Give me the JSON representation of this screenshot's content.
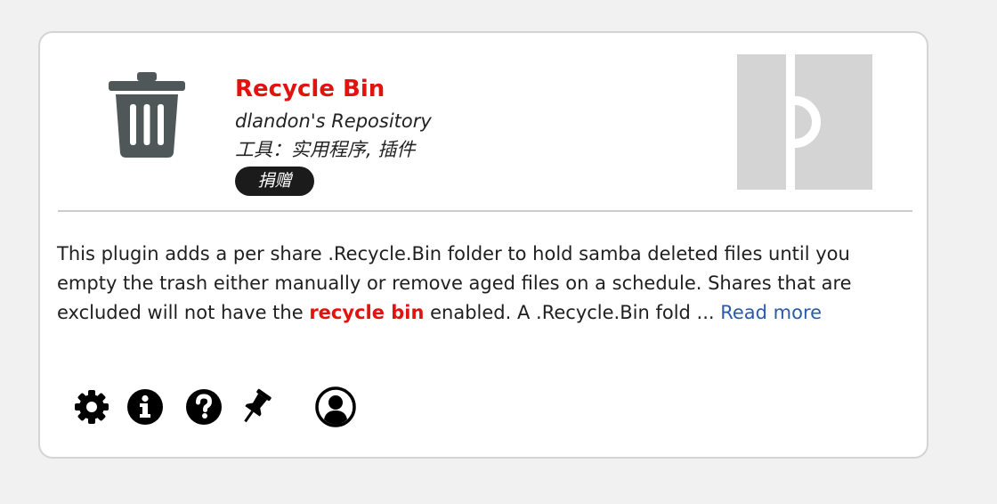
{
  "plugin": {
    "title": "Recycle Bin",
    "repository": "dlandon's Repository",
    "category": "工具：实用程序, 插件",
    "donate_label": "捐赠",
    "icon": "trash-icon",
    "author_logo": "author-logo-icon"
  },
  "description": {
    "text_before": "This plugin adds a per share .Recycle.Bin folder to hold samba deleted files until you empty the trash either manually or remove aged files on a schedule. Shares that are excluded will not have the ",
    "highlight": "recycle bin",
    "text_after": " enabled. A .Recycle.Bin fold ... ",
    "read_more": "Read more"
  },
  "actions": [
    {
      "name": "settings",
      "icon": "gear-icon"
    },
    {
      "name": "info",
      "icon": "info-icon"
    },
    {
      "name": "help",
      "icon": "help-icon"
    },
    {
      "name": "pin",
      "icon": "pin-icon"
    },
    {
      "name": "profile",
      "icon": "user-icon"
    }
  ],
  "colors": {
    "title": "#e2120f",
    "link": "#2a5aa8",
    "badge_bg": "#1b1b1b",
    "icon_gray": "#505759"
  }
}
